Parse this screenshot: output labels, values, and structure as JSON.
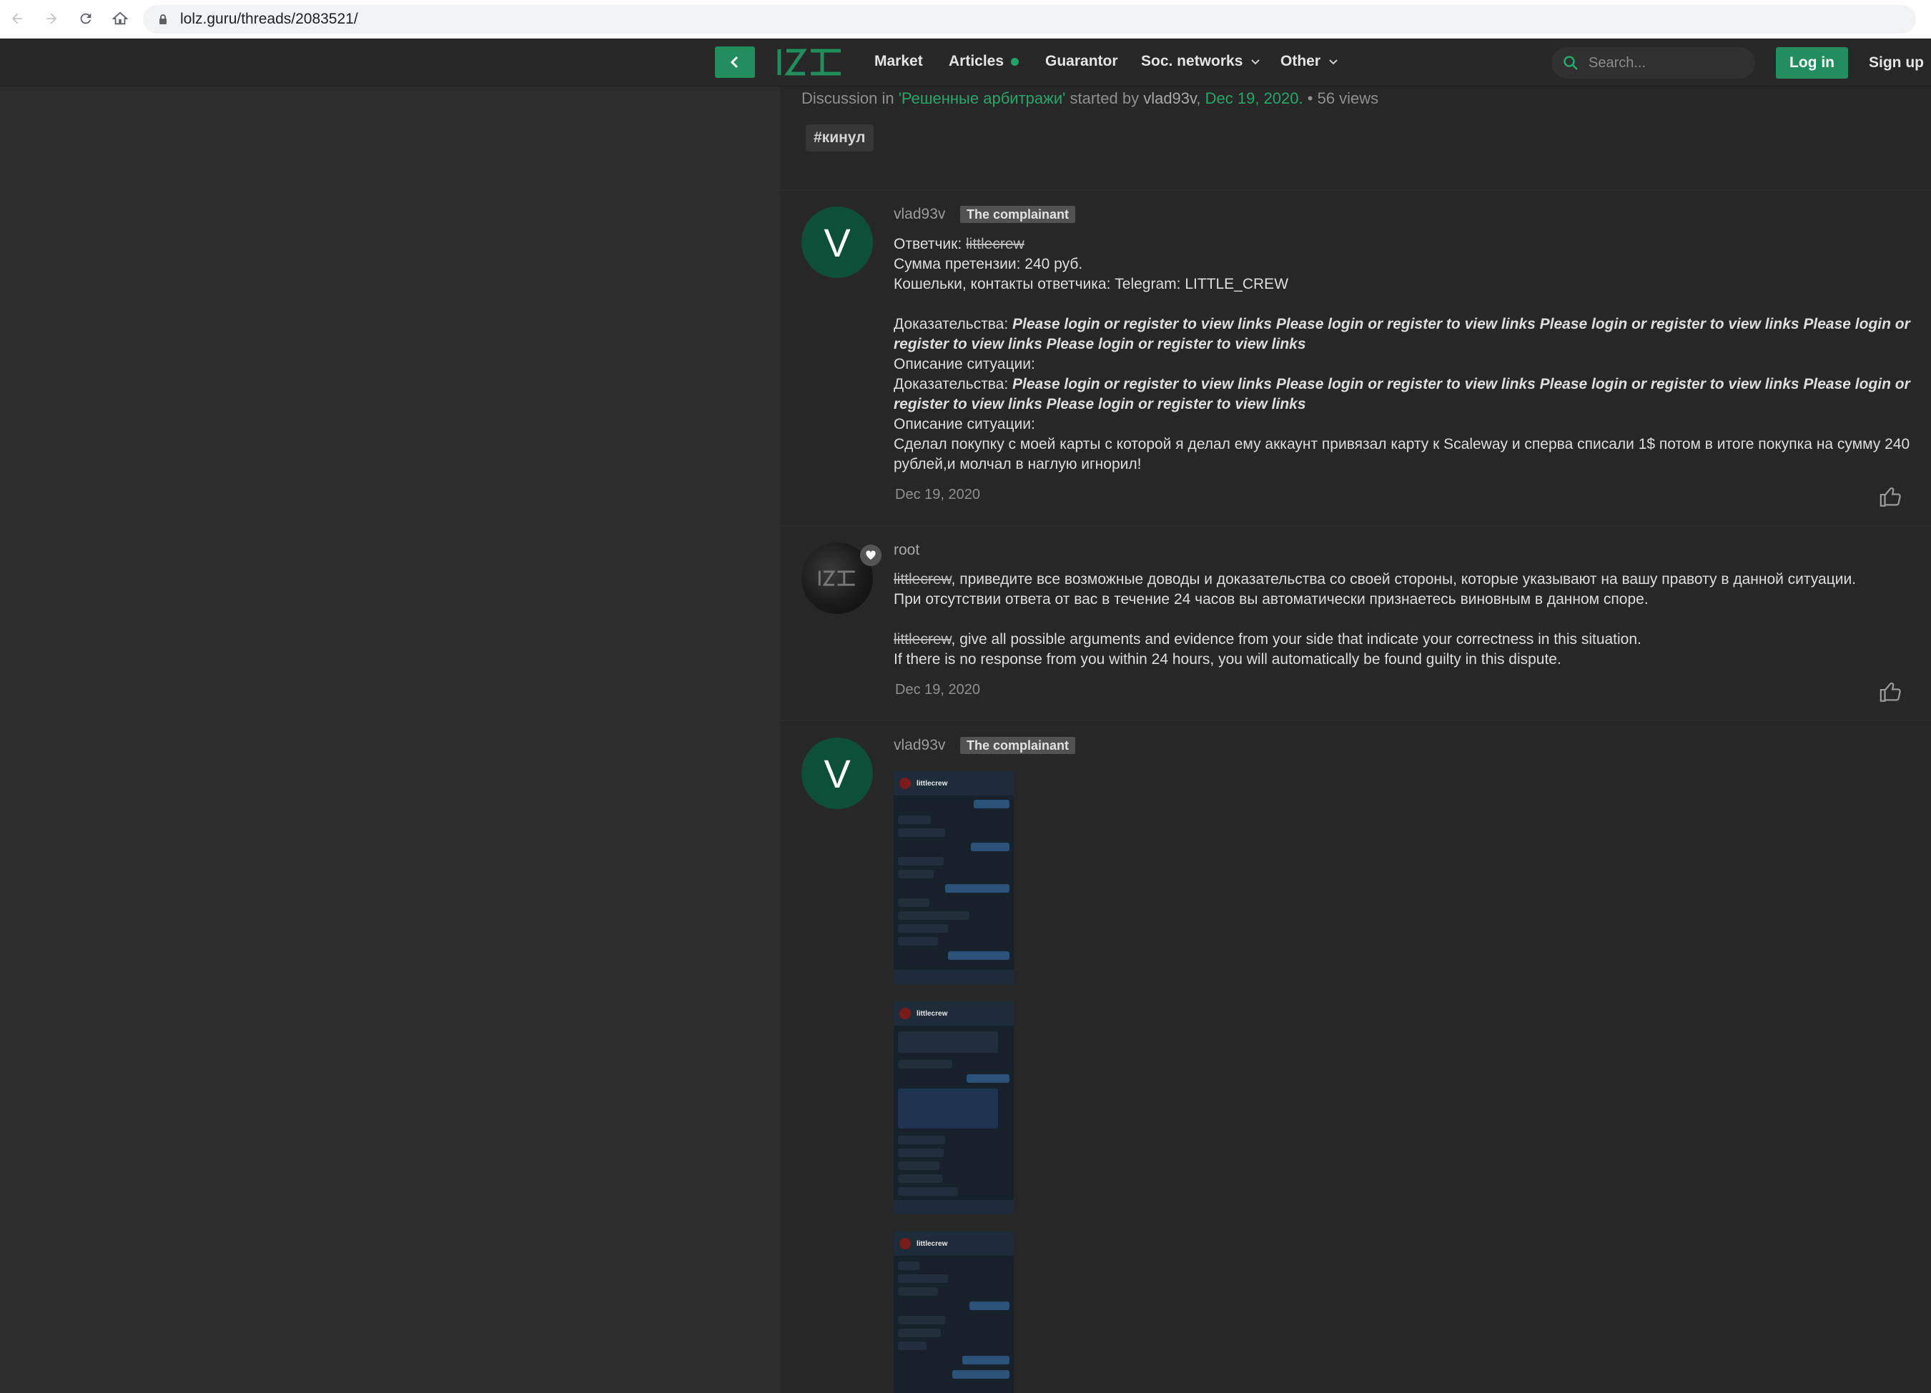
{
  "browser": {
    "url": "lolz.guru/threads/2083521/"
  },
  "header": {
    "nav": [
      {
        "label": "Market"
      },
      {
        "label": "Articles"
      },
      {
        "label": "Guarantor"
      },
      {
        "label": "Soc. networks"
      },
      {
        "label": "Other"
      }
    ],
    "search_placeholder": "Search...",
    "login_label": "Log in",
    "signup_label": "Sign up"
  },
  "thread": {
    "meta_prefix": "Discussion in",
    "forum": "'Решенные арбитражи'",
    "meta_started": "started by",
    "author": "vlad93v",
    "date": "Dec 19, 2020.",
    "views": "56 views",
    "tag": "#кинул"
  },
  "posts": [
    {
      "username": "vlad93v",
      "avatar_letter": "V",
      "badge": "The complainant",
      "line1_label": "Ответчик:",
      "line1_value": "littlecrew",
      "line2": "Сумма претензии: 240 руб.",
      "line3": "Кошельки, контакты ответчика: Telegram: LITTLE_CREW",
      "evidence_label": "Доказательства:",
      "evidence_links": "Please login or register to view links Please login or register to view links Please login or register to view links Please login or register to view links Please login or register to view links",
      "situation_label": "Описание ситуации:",
      "evidence_label_2": "Доказательства:",
      "evidence_links_2": "Please login or register to view links Please login or register to view links Please login or register to view links Please login or register to view links Please login or register to view links",
      "situation_label_2": "Описание ситуации:",
      "situation_text": "Сделал покупку с моей карты с которой я делал ему аккаунт привязал карту к Scaleway и сперва списали 1$ потом в итоге покупка на сумму 240 рублей,и молчал в наглую игнорил!",
      "date": "Dec 19, 2020"
    },
    {
      "username": "root",
      "mention": "littlecrew",
      "ru_line1": ", приведите все возможные доводы и доказательства со своей стороны, которые указывают на вашу правоту в данной ситуации.",
      "ru_line2": "При отсутствии ответа от вас в течение 24 часов вы автоматически признаетесь виновным в данном споре.",
      "en_line1": ", give all possible arguments and evidence from your side that indicate your correctness in this situation.",
      "en_line2": "If there is no response from you within 24 hours, you will automatically be found guilty in this dispute.",
      "date": "Dec 19, 2020"
    },
    {
      "username": "vlad93v",
      "avatar_letter": "V",
      "badge": "The complainant",
      "attachments": [
        {
          "title": "littlecrew"
        },
        {
          "title": "littlecrew"
        },
        {
          "title": "littlecrew"
        }
      ]
    }
  ],
  "colors": {
    "accent": "#228e5d",
    "background": "#272727",
    "avatar_bg": "#0e4f3a"
  }
}
